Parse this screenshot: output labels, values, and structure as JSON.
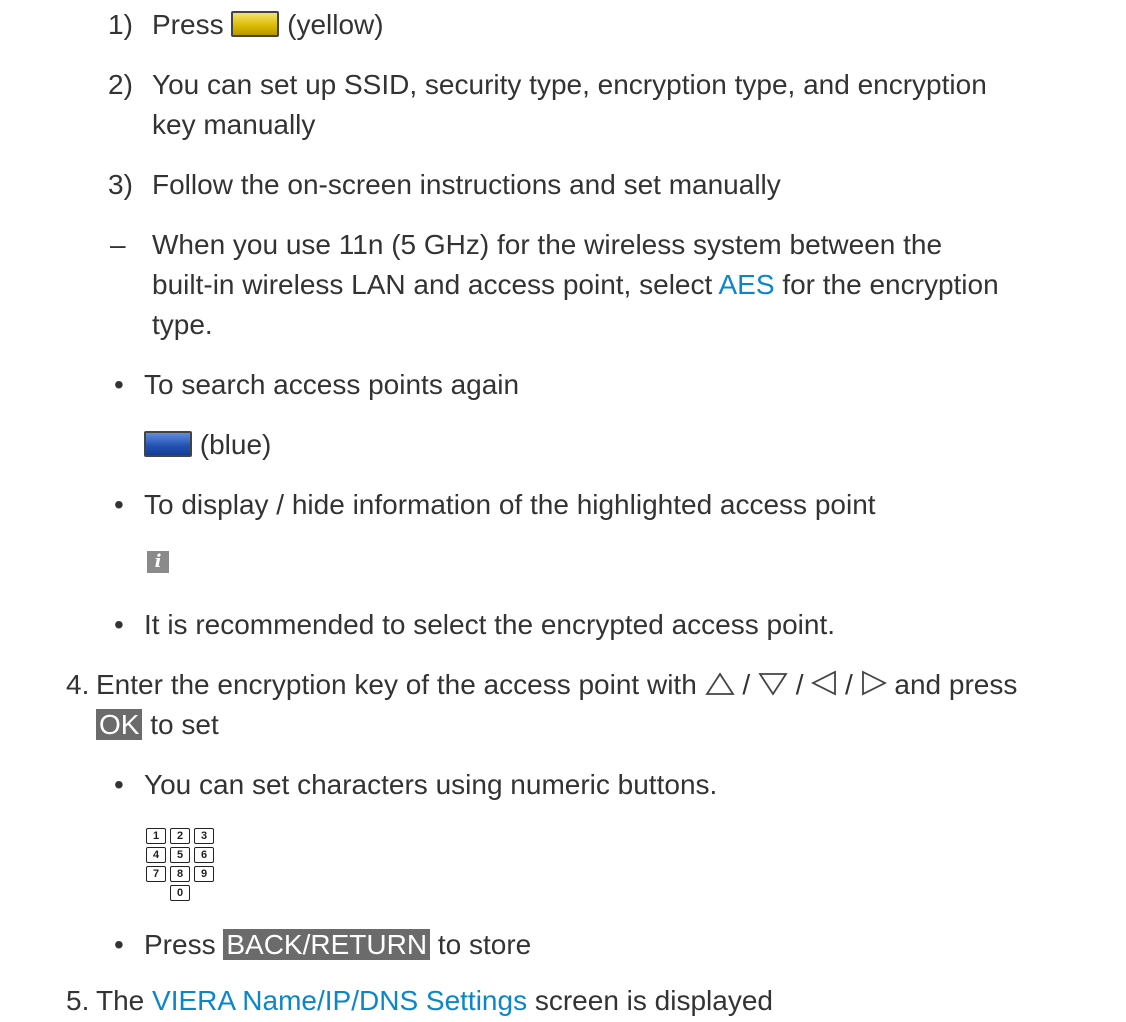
{
  "steps": {
    "sub1": {
      "num": "1)",
      "text": "Press",
      "key_label": "(yellow)"
    },
    "sub2": {
      "num": "2)",
      "line1": "You can set up SSID, security type, encryption type, and encryption",
      "line2": "key manually"
    },
    "sub3": {
      "num": "3)",
      "text": "Follow the on-screen instructions and set manually"
    },
    "note": {
      "dash": "–",
      "line1": "When you use 11n (5 GHz) for the wireless system between the",
      "line2_pre": "built-in wireless LAN and access point, select",
      "line2_link": "AES",
      "line2_post": "for the encryption",
      "line3": "type."
    },
    "bullet_search": {
      "text": "To search access points again",
      "key_label": "(blue)"
    },
    "bullet_info": {
      "text": "To display / hide information of the highlighted access point",
      "icon_glyph": "i"
    },
    "bullet_recommend": {
      "text": "It is recommended to select the encrypted access point."
    },
    "step4": {
      "num": "4.",
      "line1_pre": "Enter the encryption key of the access point with",
      "sep": "/",
      "line1_post": "and press",
      "ok": "OK",
      "line2_post": "to set"
    },
    "bullet_numeric": {
      "text": "You can set characters using numeric buttons."
    },
    "numpad": [
      "1",
      "2",
      "3",
      "4",
      "5",
      "6",
      "7",
      "8",
      "9",
      "0"
    ],
    "bullet_back": {
      "pre": "Press",
      "key": "BACK/RETURN",
      "post": "to store"
    },
    "step5": {
      "num": "5.",
      "pre": "The",
      "link": "VIERA Name/IP/DNS Settings",
      "post": "screen is displayed"
    }
  },
  "bullet_glyph": "•",
  "colors": {
    "link": "#0c86c9",
    "highlight": "#6b6b6b",
    "text": "#333333"
  }
}
